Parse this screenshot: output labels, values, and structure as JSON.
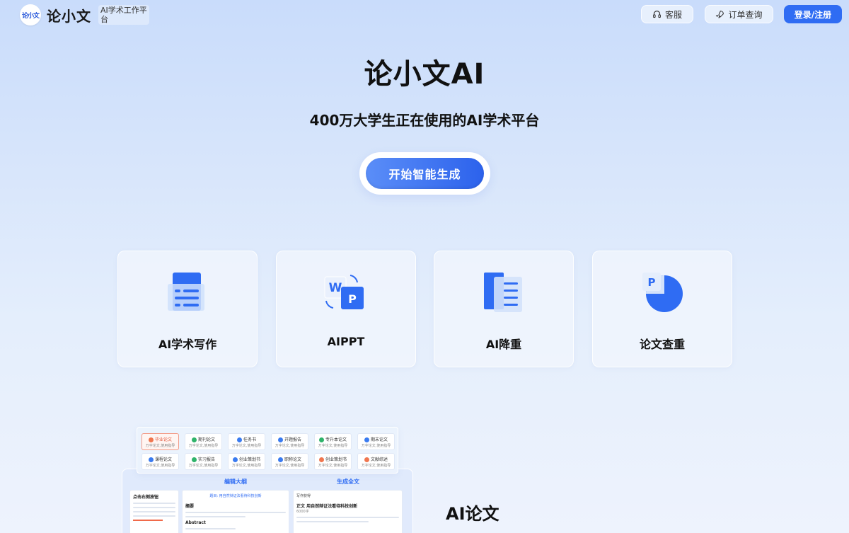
{
  "header": {
    "logo_mark": "论小文",
    "logo_text": "论小文",
    "logo_subtitle": "AI学术工作平台",
    "service_label": "客服",
    "order_label": "订单查询",
    "login_label": "登录/注册"
  },
  "hero": {
    "title": "论小文AI",
    "subtitle": "400万大学生正在使用的AI学术平台",
    "cta_label": "开始智能生成"
  },
  "features": [
    {
      "label": "AI学术写作",
      "icon": "document-list-icon"
    },
    {
      "label": "AIPPT",
      "icon": "word-ppt-icon"
    },
    {
      "label": "AI降重",
      "icon": "stacked-docs-icon"
    },
    {
      "label": "论文查重",
      "icon": "ppt-pie-icon"
    }
  ],
  "preview": {
    "chips": [
      {
        "label": "毕业论文",
        "sub": "万字论文,使用指导",
        "selected": true,
        "color": "#f0764f"
      },
      {
        "label": "期刊论文",
        "sub": "万字论文,使用指导",
        "color": "#2fb36a"
      },
      {
        "label": "任务书",
        "sub": "万字论文,使用指导",
        "color": "#3a7bf0"
      },
      {
        "label": "开题报告",
        "sub": "万字论文,使用指导",
        "color": "#3a7bf0"
      },
      {
        "label": "专升本论文",
        "sub": "万字论文,使用指导",
        "color": "#2fb36a"
      },
      {
        "label": "期末论文",
        "sub": "万字论文,使用指导",
        "color": "#3a7bf0"
      },
      {
        "label": "课程论文",
        "sub": "万字论文,使用指导",
        "color": "#3a7bf0"
      },
      {
        "label": "实习报告",
        "sub": "万字论文,使用指导",
        "color": "#2fb36a"
      },
      {
        "label": "创业策划书",
        "sub": "万字论文,使用指导",
        "color": "#3a7bf0"
      },
      {
        "label": "职称论文",
        "sub": "万字论文,使用指导",
        "color": "#3a7bf0"
      },
      {
        "label": "创业策划书",
        "sub": "万字论文,使用指导",
        "color": "#f0764f"
      },
      {
        "label": "文献综述",
        "sub": "万字论文,使用指导",
        "color": "#f0764f"
      }
    ],
    "tab_outline": "编辑大纲",
    "tab_fulltext": "生成全文",
    "outline_header": "点击右侧按钮",
    "middle_title": "题目: 用自然辩证法看待科技创新",
    "middle_abstract": "摘要",
    "middle_abstract_en": "Abstract",
    "right_header": "写作获得",
    "right_title": "正文 用自然辩证法看待科技创新",
    "right_count": "6000字",
    "section_title": "AI论文"
  }
}
